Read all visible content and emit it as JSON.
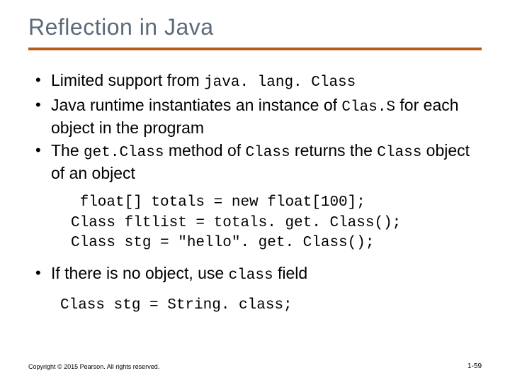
{
  "title": "Reflection in Java",
  "bullet1": {
    "prefix": "Limited support from ",
    "code1": "java. lang. Class"
  },
  "bullet2": {
    "part1": "Java runtime instantiates an instance of ",
    "code1": "Clas.S",
    "part2": " for each object in the program"
  },
  "bullet3": {
    "part1": "The ",
    "code1": "get.Class",
    "part2": " method of ",
    "code2": "Class",
    "part3": " returns the ",
    "code3": "Class",
    "part4": " object of an object"
  },
  "code_block1": " float[] totals = new float[100];\nClass fltlist = totals. get. Class();\nClass stg = ″hello″. get. Class();",
  "bullet4": {
    "part1": "If there is no object, use ",
    "code1": "class",
    "part2": " field"
  },
  "code_block2": "Class stg = String. class;",
  "footer_left": "Copyright © 2015 Pearson. All rights reserved.",
  "footer_right": "1-59"
}
